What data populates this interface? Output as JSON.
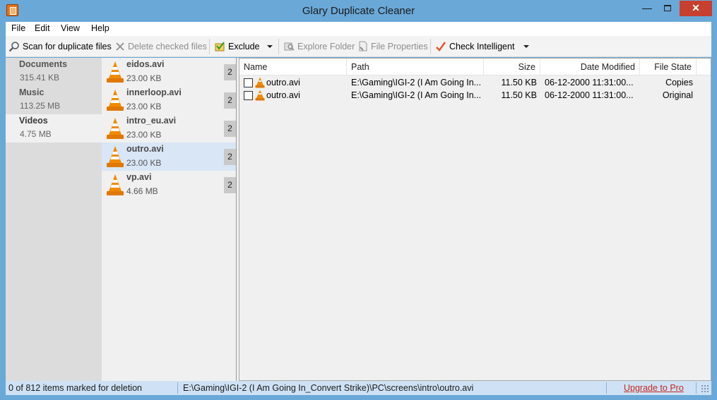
{
  "window": {
    "title": "Glary Duplicate Cleaner"
  },
  "titlebar": {
    "minimize": "—",
    "close": "✕"
  },
  "menu": [
    "File",
    "Edit",
    "View",
    "Help"
  ],
  "toolbar": {
    "scan": "Scan for duplicate files",
    "delete": "Delete checked files",
    "exclude": "Exclude",
    "explore": "Explore Folder",
    "properties": "File Properties",
    "check": "Check Intelligent"
  },
  "categories": [
    {
      "name": "Documents",
      "size": "315.41 KB"
    },
    {
      "name": "Music",
      "size": "113.25 MB"
    },
    {
      "name": "Videos",
      "size": "4.75 MB",
      "selected": true
    }
  ],
  "groups": [
    {
      "name": "eidos.avi",
      "size": "23.00 KB",
      "count": "2"
    },
    {
      "name": "innerloop.avi",
      "size": "23.00 KB",
      "count": "2"
    },
    {
      "name": "intro_eu.avi",
      "size": "23.00 KB",
      "count": "2"
    },
    {
      "name": "outro.avi",
      "size": "23.00 KB",
      "count": "2",
      "selected": true
    },
    {
      "name": "vp.avi",
      "size": "4.66 MB",
      "count": "2"
    }
  ],
  "table": {
    "headers": {
      "name": "Name",
      "path": "Path",
      "size": "Size",
      "date": "Date Modified",
      "state": "File State"
    },
    "rows": [
      {
        "name": "outro.avi",
        "path": "E:\\Gaming\\IGI-2 (I Am Going In...",
        "size": "11.50 KB",
        "date": "06-12-2000 11:31:00...",
        "state": "Copies",
        "checked": false
      },
      {
        "name": "outro.avi",
        "path": "E:\\Gaming\\IGI-2 (I Am Going In...",
        "size": "11.50 KB",
        "date": "06-12-2000 11:31:00...",
        "state": "Original",
        "checked": false
      }
    ]
  },
  "status": {
    "marked": "0 of 812 items marked for deletion",
    "path": "E:\\Gaming\\IGI-2 (I Am Going In_Convert Strike)\\PC\\screens\\intro\\outro.avi",
    "upgrade": "Upgrade to Pro"
  },
  "colors": {
    "accent": "#6aa8d8",
    "close": "#c7402f",
    "selection": "#d9e6f6",
    "upgrade": "#c4271f"
  }
}
